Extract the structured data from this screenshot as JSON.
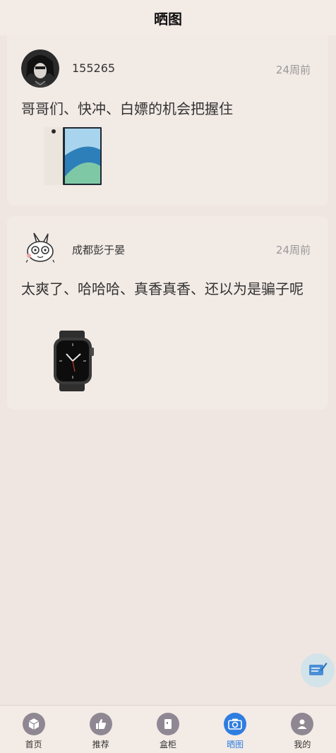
{
  "header": {
    "title": "晒图"
  },
  "posts": [
    {
      "username": "155265",
      "time": "24周前",
      "content": "哥哥们、快冲、白嫖的机会把握住",
      "image": "iphone-photo"
    },
    {
      "username": "成都彭于晏",
      "time": "24周前",
      "content": "太爽了、哈哈哈、真香真香、还以为是骗子呢",
      "image": "apple-watch-photo"
    }
  ],
  "fab": {
    "icon": "compose-icon"
  },
  "tabbar": {
    "active_index": 3,
    "active_color": "#2f7de1",
    "tabs": [
      {
        "label": "首页",
        "icon": "cube-icon"
      },
      {
        "label": "推荐",
        "icon": "thumbs-up-icon"
      },
      {
        "label": "盒柜",
        "icon": "cabinet-icon"
      },
      {
        "label": "晒图",
        "icon": "camera-icon"
      },
      {
        "label": "我的",
        "icon": "user-icon"
      }
    ]
  }
}
